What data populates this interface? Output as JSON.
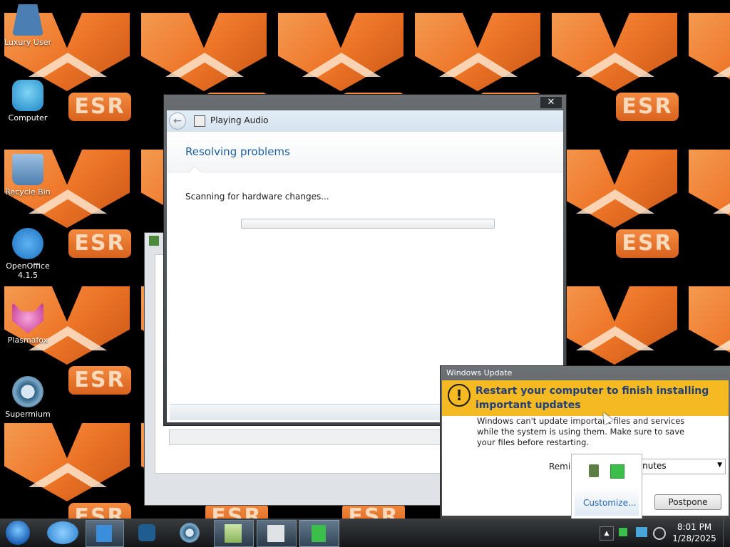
{
  "desktop": {
    "badge_text": "ESR",
    "icons": [
      {
        "label": "Luxury User",
        "icon": "user-icon",
        "color": "#4b7fb3"
      },
      {
        "label": "Computer",
        "icon": "computer-icon",
        "color": "#1e9fd8"
      },
      {
        "label": "Recycle Bin",
        "icon": "recycle-bin-icon",
        "color": "#5f8fbf"
      },
      {
        "label": "OpenOffice\n4.1.5",
        "icon": "openoffice-icon",
        "color": "#1f86d6"
      },
      {
        "label": "Plasmafox",
        "icon": "plasmafox-icon",
        "color": "#d84aa5"
      },
      {
        "label": "Supermium",
        "icon": "supermium-icon",
        "color": "#3b6f9a"
      }
    ]
  },
  "troubleshooter": {
    "title": "Playing Audio",
    "heading": "Resolving problems",
    "status": "Scanning for hardware changes...",
    "progress": 0
  },
  "update_popup": {
    "title": "Windows Update",
    "heading": "Restart your computer to finish installing important updates",
    "body": "Windows can't update important files and services while the system is using them. Make sure to save your files before restarting.",
    "remind_label": "Remind me in:",
    "remind_value": "10 minutes",
    "postpone_label": "Postpone"
  },
  "tray_flyout": {
    "customize_label": "Customize..."
  },
  "taskbar": {
    "time": "8:01 PM",
    "date": "1/28/2025",
    "buttons": [
      "start-orb-icon",
      "ie-icon",
      "files-icon",
      "media-player-icon",
      "supermium-taskbar-icon",
      "ie-map-icon",
      "disk-icon",
      "update-taskbar-icon"
    ]
  },
  "colors": {
    "accent_orange": "#ee7628",
    "update_bar": "#f5b921",
    "taskbar": "#1b1d20"
  }
}
